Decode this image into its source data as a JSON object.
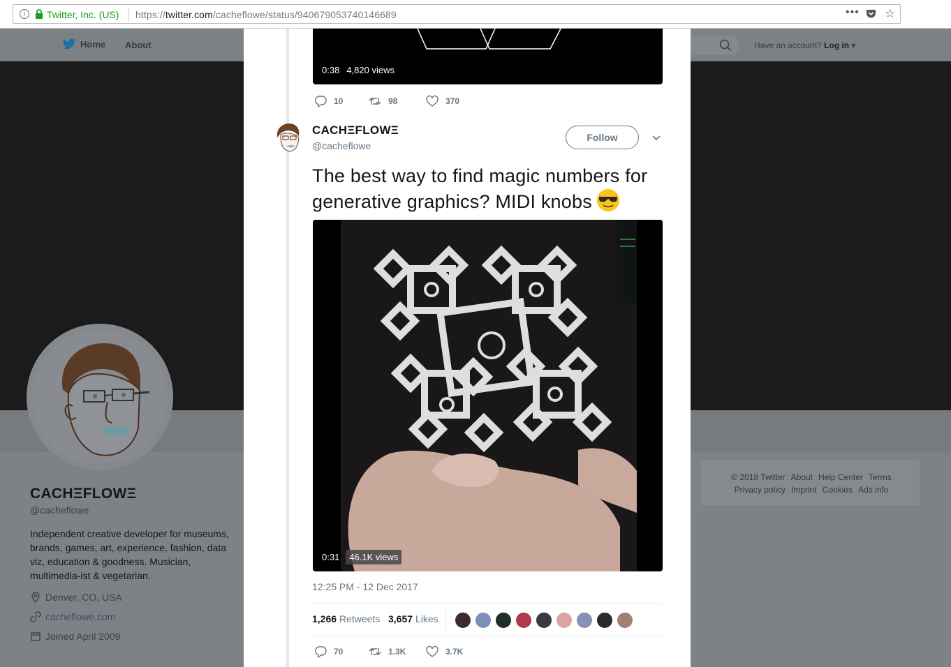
{
  "browser": {
    "company": "Twitter, Inc. (US)",
    "url_prefix": "https://",
    "url_host": "twitter.com",
    "url_path": "/cacheflowe/status/940679053740146689",
    "menu_dots": "•••"
  },
  "nav": {
    "home": "Home",
    "about": "About",
    "have_account": "Have an account?",
    "login": "Log in"
  },
  "profile": {
    "name": "CACHΞFLOWΞ",
    "handle": "@cacheflowe",
    "bio": "Independent creative developer for museums, brands, games, art, experience, fashion, data viz, education & goodness. Musician, multimedia-ist & vegetarian.",
    "location": "Denver, CO, USA",
    "website": "cacheflowe.com",
    "joined": "Joined April 2009"
  },
  "footer": {
    "line1": [
      "© 2018 Twitter",
      "About",
      "Help Center",
      "Terms"
    ],
    "line2": [
      "Privacy policy",
      "Imprint",
      "Cookies",
      "Ads info"
    ]
  },
  "prev_tweet": {
    "video_duration": "0:38",
    "video_views": "4,820 views",
    "replies": "10",
    "retweets": "98",
    "likes": "370"
  },
  "tweet": {
    "author_name": "CACHΞFLOWΞ",
    "author_handle": "@cacheflowe",
    "follow_label": "Follow",
    "text": "The best way to find magic numbers for generative graphics? MIDI knobs",
    "emoji": "smiling-face-with-sunglasses",
    "video_duration": "0:31",
    "video_views": "46.1K views",
    "timestamp": "12:25 PM - 12 Dec 2017",
    "retweet_count": "1,266",
    "retweet_label": "Retweets",
    "like_count": "3,657",
    "like_label": "Likes",
    "replies": "70",
    "retweets": "1.3K",
    "likes": "3.7K"
  },
  "likers": [
    "#3b2b2b",
    "#7b8fb8",
    "#1e2f2a",
    "#b03a4a",
    "#3a3a3a",
    "#d9a5a0",
    "#8890b5",
    "#2a2a2a",
    "#a08070"
  ],
  "colors": {
    "twitter_blue": "#1da1f2",
    "secure_green": "#17a014",
    "muted_gray": "#657786",
    "text_dark": "#14171a"
  }
}
